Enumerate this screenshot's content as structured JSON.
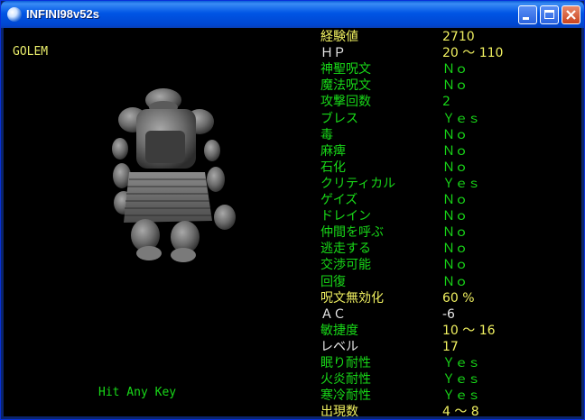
{
  "window": {
    "title": "INFINI98v52s"
  },
  "monster": {
    "name": "GOLEM"
  },
  "footer": {
    "prompt": "Hit Any Key"
  },
  "stats": [
    {
      "label": "経験値",
      "value": "2710",
      "label_color": "yellow",
      "value_color": "yellow"
    },
    {
      "label": "ＨＰ",
      "value": "20 〜 110",
      "label_color": "white",
      "value_color": "yellow"
    },
    {
      "label": "神聖呪文",
      "value": "Ｎｏ",
      "label_color": "green",
      "value_color": "green"
    },
    {
      "label": "魔法呪文",
      "value": "Ｎｏ",
      "label_color": "green",
      "value_color": "green"
    },
    {
      "label": "攻撃回数",
      "value": "2",
      "label_color": "green",
      "value_color": "green"
    },
    {
      "label": "ブレス",
      "value": "Ｙｅｓ",
      "label_color": "green",
      "value_color": "green"
    },
    {
      "label": "毒",
      "value": "Ｎｏ",
      "label_color": "green",
      "value_color": "green"
    },
    {
      "label": "麻痺",
      "value": "Ｎｏ",
      "label_color": "green",
      "value_color": "green"
    },
    {
      "label": "石化",
      "value": "Ｎｏ",
      "label_color": "green",
      "value_color": "green"
    },
    {
      "label": "クリティカル",
      "value": "Ｙｅｓ",
      "label_color": "green",
      "value_color": "green"
    },
    {
      "label": "ゲイズ",
      "value": "Ｎｏ",
      "label_color": "green",
      "value_color": "green"
    },
    {
      "label": "ドレイン",
      "value": "Ｎｏ",
      "label_color": "green",
      "value_color": "green"
    },
    {
      "label": "仲間を呼ぶ",
      "value": "Ｎｏ",
      "label_color": "green",
      "value_color": "green"
    },
    {
      "label": "逃走する",
      "value": "Ｎｏ",
      "label_color": "green",
      "value_color": "green"
    },
    {
      "label": "交渉可能",
      "value": "Ｎｏ",
      "label_color": "green",
      "value_color": "green"
    },
    {
      "label": "回復",
      "value": "Ｎｏ",
      "label_color": "green",
      "value_color": "green"
    },
    {
      "label": "呪文無効化",
      "value": "60 %",
      "label_color": "yellow",
      "value_color": "yellow"
    },
    {
      "label": "ＡＣ",
      "value": "-6",
      "label_color": "white",
      "value_color": "white"
    },
    {
      "label": "敏捷度",
      "value": "10 〜 16",
      "label_color": "green",
      "value_color": "yellow"
    },
    {
      "label": "レベル",
      "value": "17",
      "label_color": "white",
      "value_color": "yellow"
    },
    {
      "label": "眠り耐性",
      "value": "Ｙｅｓ",
      "label_color": "green",
      "value_color": "green"
    },
    {
      "label": "火炎耐性",
      "value": "Ｙｅｓ",
      "label_color": "green",
      "value_color": "green"
    },
    {
      "label": "寒冷耐性",
      "value": "Ｙｅｓ",
      "label_color": "green",
      "value_color": "green"
    },
    {
      "label": "出現数",
      "value": "4 〜 8",
      "label_color": "yellow",
      "value_color": "yellow"
    }
  ]
}
